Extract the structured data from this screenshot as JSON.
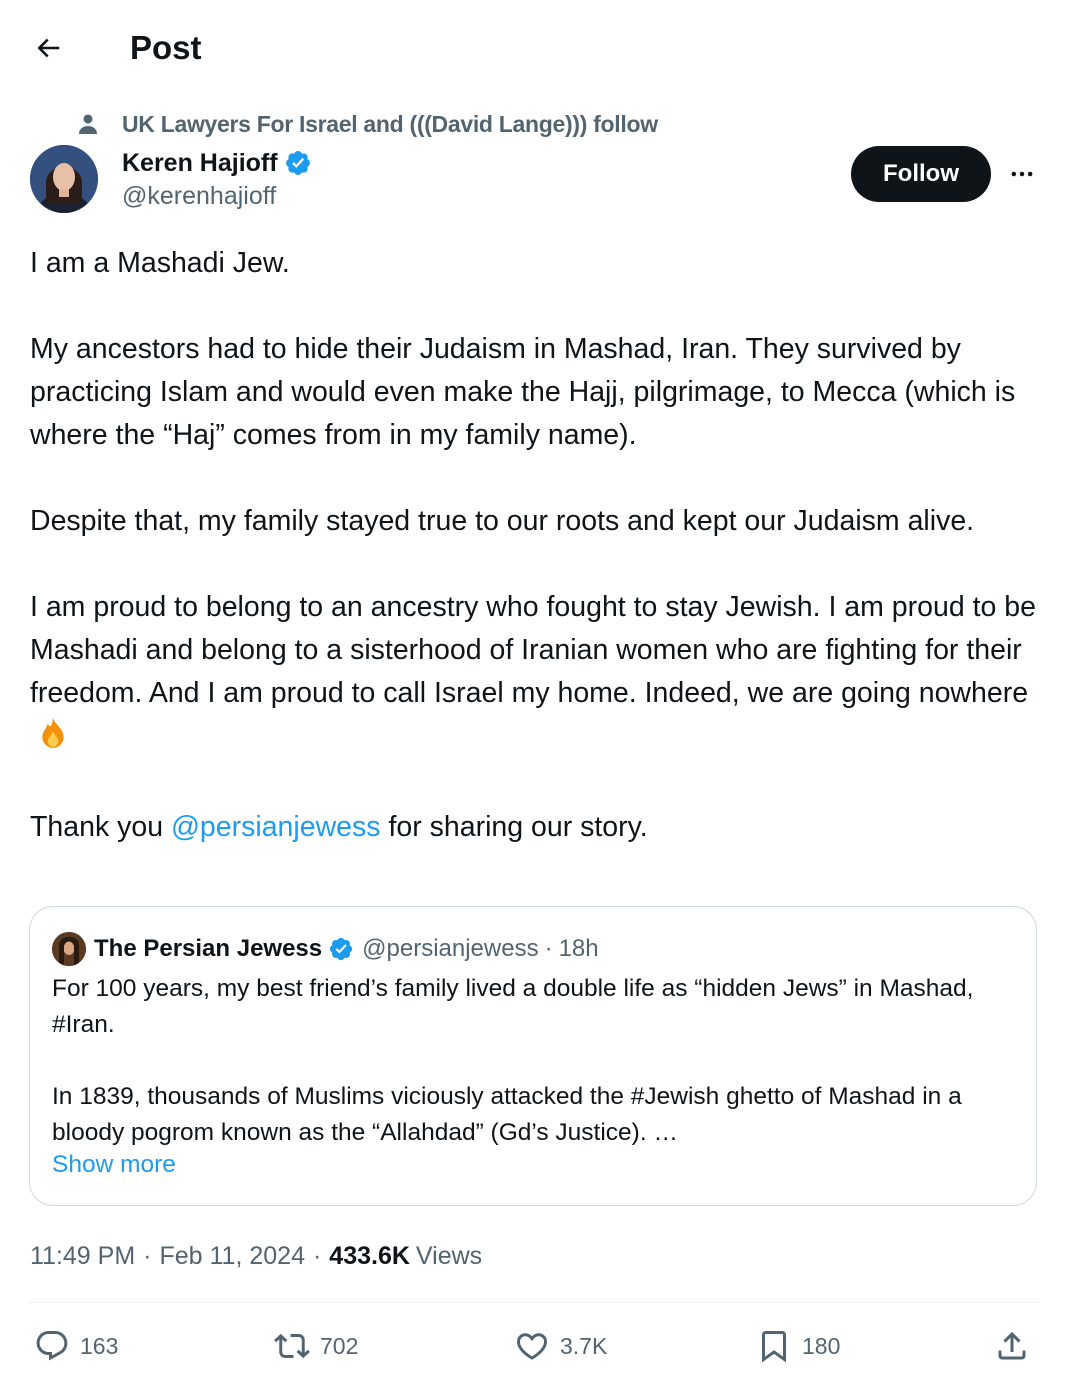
{
  "header": {
    "title": "Post"
  },
  "social_context": {
    "text": "UK Lawyers For Israel and (((David Lange))) follow"
  },
  "author": {
    "name": "Keren Hajioff",
    "handle": "@kerenhajioff",
    "verified": true
  },
  "follow_button": {
    "label": "Follow"
  },
  "tweet": {
    "p1": "I am a Mashadi Jew.",
    "p2": "My ancestors had to hide their Judaism in Mashad, Iran. They survived by practicing Islam and would even make the Hajj, pilgrimage, to Mecca (which is where the “Haj” comes from in my family name).",
    "p3": "Despite that, my family stayed true to our roots and kept our Judaism alive.",
    "p4": "I am proud to belong to an ancestry who fought to stay Jewish. I am proud to be Mashadi and belong to a sisterhood of Iranian women who are fighting for their freedom. And I am proud to call Israel my home. Indeed, we are going nowhere",
    "p5_before": "Thank you ",
    "p5_mention": "@persianjewess",
    "p5_after": " for sharing our story."
  },
  "quote": {
    "name": "The Persian Jewess",
    "handle": "@persianjewess",
    "separator": "·",
    "time": "18h",
    "body_p1": "For 100 years, my best friend’s family lived a double life as “hidden Jews” in Mashad, #Iran.",
    "body_p2": "In 1839, thousands of Muslims viciously attacked the #Jewish ghetto of Mashad in a bloody pogrom known as the “Allahdad” (Gd’s Justice).  …",
    "show_more": "Show more"
  },
  "meta": {
    "time": "11:49 PM",
    "separator": "·",
    "date": "Feb 11, 2024",
    "views_count": "433.6K",
    "views_label": "Views"
  },
  "actions": {
    "replies": "163",
    "reposts": "702",
    "likes": "3.7K",
    "bookmarks": "180"
  },
  "icons": {
    "back": "arrow-left-icon",
    "social_context": "person-icon",
    "verified": "verified-badge-icon",
    "more": "more-dots-icon",
    "fire": "fire-emoji-icon",
    "reply": "reply-icon",
    "repost": "repost-icon",
    "like": "heart-icon",
    "bookmark": "bookmark-icon",
    "share": "share-icon"
  },
  "colors": {
    "accent": "#1d9bf0",
    "text": "#0f1419",
    "secondary": "#536471",
    "border": "#cfd9de"
  }
}
